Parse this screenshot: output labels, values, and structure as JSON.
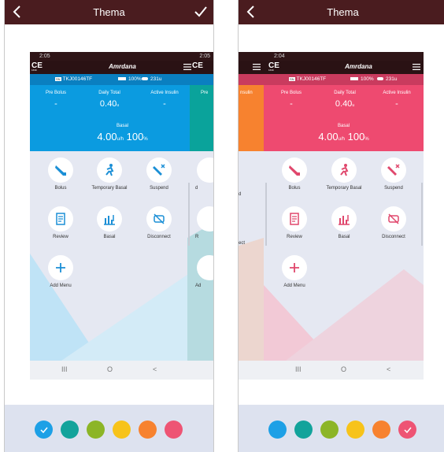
{
  "header": {
    "title": "Thema"
  },
  "phone": {
    "status_time_1": "2:05",
    "status_time_peek": "2:05",
    "status_time_2": "2:04",
    "brand": "Amrdana",
    "ce_mark": "CE",
    "ce_number": "1639",
    "serial": "TKJ00146TF",
    "battery": "100%",
    "reservoir": "231u",
    "pre_bolus_label": "Pre Bolus",
    "pre_bolus_value": "-",
    "daily_total_label": "Daily Total",
    "daily_total_value": "0.40",
    "daily_total_unit": "u",
    "active_insulin_label": "Active Insulin",
    "active_insulin_value": "-",
    "peek_pre_label": "Pre",
    "peek_insulin_label": "nsulin",
    "basal_label": "Basal",
    "basal_value": "4.00",
    "basal_unit": "u/h",
    "basal_percent": "100",
    "basal_percent_unit": "%",
    "menu": {
      "bolus": "Bolus",
      "temp_basal": "Temporary Basal",
      "suspend": "Suspend",
      "review": "Review",
      "basal": "Basal",
      "disconnect": "Disconnect",
      "add_menu": "Add Menu"
    },
    "peek_labels": {
      "d": "d",
      "ect": "ect",
      "r": "R",
      "ad": "Ad"
    },
    "nav": {
      "recents": "III",
      "home": "O",
      "back": "<"
    }
  },
  "themes": {
    "blue": {
      "accent": "#0b9be0",
      "infobar": "#0a7fc0",
      "peek": "#0aa39b",
      "triangle": "#bfe3f6",
      "icon": "#1b8fd6"
    },
    "pink": {
      "accent": "#ee4a70",
      "infobar": "#c93b5e",
      "peek": "#f7822f",
      "triangle": "#f2c9d6",
      "icon": "#e0476c"
    }
  },
  "swatches": [
    {
      "color": "#1da0e6",
      "name": "blue"
    },
    {
      "color": "#12a39b",
      "name": "teal"
    },
    {
      "color": "#8cb527",
      "name": "green"
    },
    {
      "color": "#f7c31a",
      "name": "yellow"
    },
    {
      "color": "#f7822f",
      "name": "orange"
    },
    {
      "color": "#ee5474",
      "name": "pink"
    }
  ],
  "selected": {
    "screen1": "blue",
    "screen2": "pink"
  },
  "icons": {
    "back": "chevron-left-icon",
    "confirm": "check-icon",
    "selected": "check-icon"
  }
}
